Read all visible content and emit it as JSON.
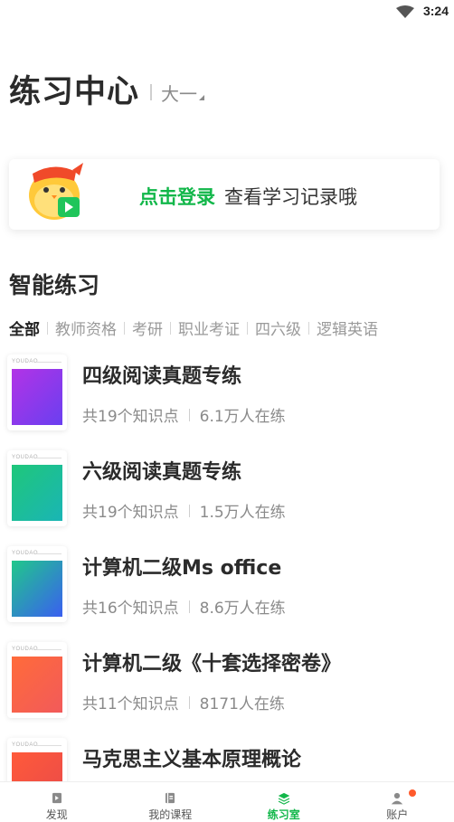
{
  "status_bar": {
    "time": "3:24",
    "wifi_icon": "wifi-icon"
  },
  "header": {
    "title": "练习中心",
    "grade": "大一"
  },
  "login": {
    "link_label": "点击登录",
    "hint": "查看学习记录哦",
    "mascot_icon": "mascot-chick-icon"
  },
  "section": {
    "title": "智能练习"
  },
  "filters": [
    {
      "label": "全部",
      "active": true
    },
    {
      "label": "教师资格",
      "active": false
    },
    {
      "label": "考研",
      "active": false
    },
    {
      "label": "职业考证",
      "active": false
    },
    {
      "label": "四六级",
      "active": false
    },
    {
      "label": "逻辑英语",
      "active": false
    }
  ],
  "courses": [
    {
      "name": "四级阅读真题专练",
      "knowledge": "共19个知识点",
      "learners": "6.1万人在练",
      "brand": "YOUDAO",
      "colors": [
        "#b233e6",
        "#6a3ff0"
      ]
    },
    {
      "name": "六级阅读真题专练",
      "knowledge": "共19个知识点",
      "learners": "1.5万人在练",
      "brand": "YOUDAO",
      "colors": [
        "#1fc77a",
        "#1ab5b5"
      ]
    },
    {
      "name": "计算机二级Ms office",
      "knowledge": "共16个知识点",
      "learners": "8.6万人在练",
      "brand": "YOUDAO",
      "colors": [
        "#20c88a",
        "#3a5ff0"
      ]
    },
    {
      "name": "计算机二级《十套选择密卷》",
      "knowledge": "共11个知识点",
      "learners": "8171人在练",
      "brand": "YOUDAO",
      "colors": [
        "#ff6b3a",
        "#f25a5a"
      ]
    },
    {
      "name": "马克思主义基本原理概论",
      "knowledge": "",
      "learners": "",
      "brand": "YOUDAO",
      "colors": [
        "#ff5a3a",
        "#e94a4a"
      ]
    }
  ],
  "tabbar": [
    {
      "label": "发现",
      "icon": "discover-icon",
      "active": false
    },
    {
      "label": "我的课程",
      "icon": "notebook-icon",
      "active": false
    },
    {
      "label": "练习室",
      "icon": "stack-icon",
      "active": true
    },
    {
      "label": "账户",
      "icon": "user-icon",
      "active": false,
      "badge": true
    }
  ],
  "colors": {
    "accent": "#12b74a",
    "badge": "#ff5a2c"
  }
}
